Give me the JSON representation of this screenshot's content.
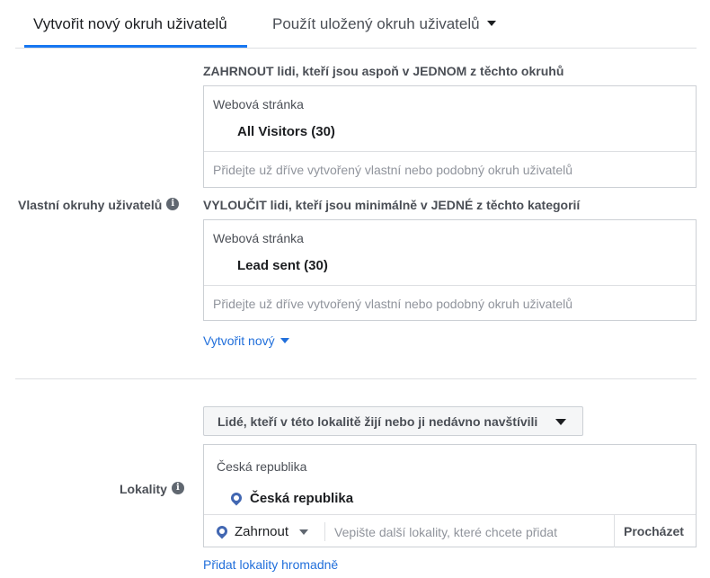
{
  "tabs": {
    "active": "Vytvořit nový okruh uživatelů",
    "second": "Použít uložený okruh uživatelů"
  },
  "custom_audiences": {
    "label": "Vlastní okruhy uživatelů",
    "include": {
      "heading": "ZAHRNOUT lidi, kteří jsou aspoň v JEDNOM z těchto okruhů",
      "group_label": "Webová stránka",
      "item": "All Visitors (30)",
      "placeholder": "Přidejte už dříve vytvořený vlastní nebo podobný okruh uživatelů"
    },
    "exclude": {
      "heading": "VYLOUČIT lidi, kteří jsou minimálně v JEDNÉ z těchto kategorií",
      "group_label": "Webová stránka",
      "item": "Lead sent (30)",
      "placeholder": "Přidejte už dříve vytvořený vlastní nebo podobný okruh uživatelů"
    },
    "create_new": "Vytvořit nový"
  },
  "locations": {
    "label": "Lokality",
    "filter": "Lidé, kteří v této lokalitě žijí nebo ji nedávno navštívili",
    "group_label": "Česká republika",
    "selected": "Česká republika",
    "include_mode": "Zahrnout",
    "placeholder": "Vepište další lokality, které chcete přidat",
    "browse": "Procházet",
    "bulk_add": "Přidat lokality hromadně"
  },
  "colors": {
    "accent": "#1877f2",
    "link": "#216fdb",
    "pin": "#4267b2"
  },
  "icons": [
    "info-icon",
    "caret-down-icon",
    "location-pin-icon"
  ]
}
